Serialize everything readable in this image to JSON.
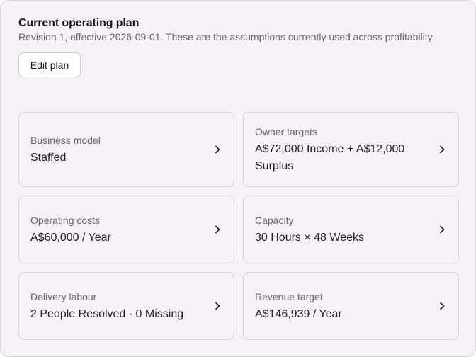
{
  "plan": {
    "title": "Current operating plan",
    "subtitle": "Revision 1, effective 2026-09-01. These are the assumptions currently used across profitability.",
    "edit_label": "Edit plan"
  },
  "cards": [
    {
      "label": "Business model",
      "value": "Staffed"
    },
    {
      "label": "Owner targets",
      "value": "A$72,000 Income + A$12,000 Surplus"
    },
    {
      "label": "Operating costs",
      "value": "A$60,000 / Year"
    },
    {
      "label": "Capacity",
      "value": "30 Hours × 48 Weeks"
    },
    {
      "label": "Delivery labour",
      "value": "2 People Resolved · 0 Missing"
    },
    {
      "label": "Revenue target",
      "value": "A$146,939 / Year"
    }
  ],
  "icons": {
    "card_chevron": "chevron-right-icon"
  }
}
